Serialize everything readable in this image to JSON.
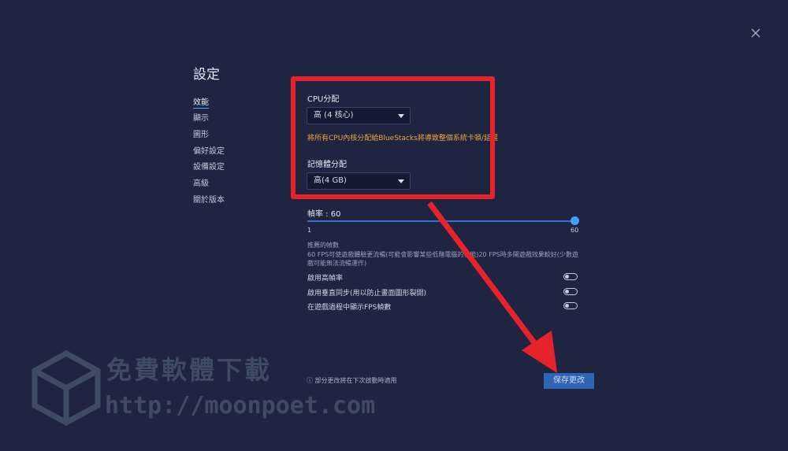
{
  "page": {
    "title": "設定"
  },
  "sidebar": {
    "items": [
      {
        "label": "效能",
        "active": true
      },
      {
        "label": "顯示"
      },
      {
        "label": "圖形"
      },
      {
        "label": "偏好設定"
      },
      {
        "label": "設備設定"
      },
      {
        "label": "高級"
      },
      {
        "label": "關於版本"
      }
    ]
  },
  "performance": {
    "cpu_label": "CPU分配",
    "cpu_value": "高 (4 核心)",
    "cpu_warning": "將所有CPU內核分配給BlueStacks將導致整個系統卡頓/延遲",
    "memory_label": "記憶體分配",
    "memory_value": "高(4 GB)",
    "fps_label": "幀率 : 60",
    "fps_min": "1",
    "fps_max": "60",
    "fps_value": 60,
    "recommended_label": "推薦的幀數",
    "recommended_desc": "60 FPS可使遊戲體驗更流暢(可能會影響某些低階電腦的性能)20 FPS時多開遊戲效果較好(少數遊戲可能無法流暢運作)"
  },
  "toggles": [
    {
      "label": "啟用高幀率",
      "on": false
    },
    {
      "label": "啟用垂直同步(用以防止畫面圖形裂開)",
      "on": false
    },
    {
      "label": "在遊戲過程中顯示FPS幀數",
      "on": false
    }
  ],
  "footer": {
    "note_icon": "ⓘ",
    "note": "部分更改將在下次啟動時適用",
    "save_label": "保存更改"
  },
  "watermark": {
    "text": "免費軟體下載",
    "url": "http://moonpoet.com"
  },
  "colors": {
    "background": "#1f2541",
    "accent": "#3ea0ff",
    "warning": "#f0a43a",
    "annotation_red": "#e6232a",
    "save_button": "#2f63b4"
  }
}
